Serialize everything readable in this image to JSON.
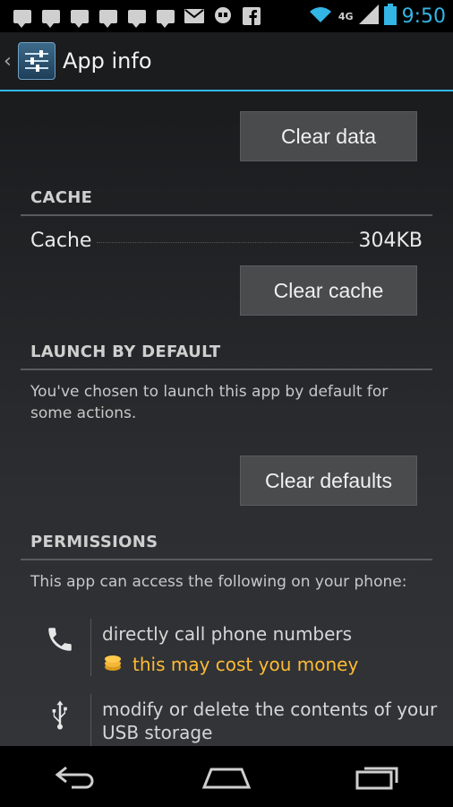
{
  "status_bar": {
    "time": "9:50",
    "network": "4G",
    "notification_icons": [
      "chat-icon",
      "chat-icon",
      "chat-icon",
      "chat-icon",
      "chat-icon",
      "chat-icon",
      "gmail-icon",
      "hangouts-icon",
      "facebook-icon"
    ],
    "accent_color": "#33b5e5"
  },
  "action_bar": {
    "title": "App info"
  },
  "storage": {
    "clear_data_label": "Clear data"
  },
  "cache": {
    "header": "CACHE",
    "label": "Cache",
    "value": "304KB",
    "clear_label": "Clear cache"
  },
  "launch": {
    "header": "LAUNCH BY DEFAULT",
    "description": "You've chosen to launch this app by default for some actions.",
    "clear_label": "Clear defaults"
  },
  "permissions": {
    "header": "PERMISSIONS",
    "intro": "This app can access the following on your phone:",
    "items": [
      {
        "icon": "phone-icon",
        "text": "directly call phone numbers",
        "warning": "this may cost you money"
      },
      {
        "icon": "usb-icon",
        "text": "modify or delete the contents of your USB storage"
      }
    ],
    "warning_color": "#ffbb33"
  }
}
